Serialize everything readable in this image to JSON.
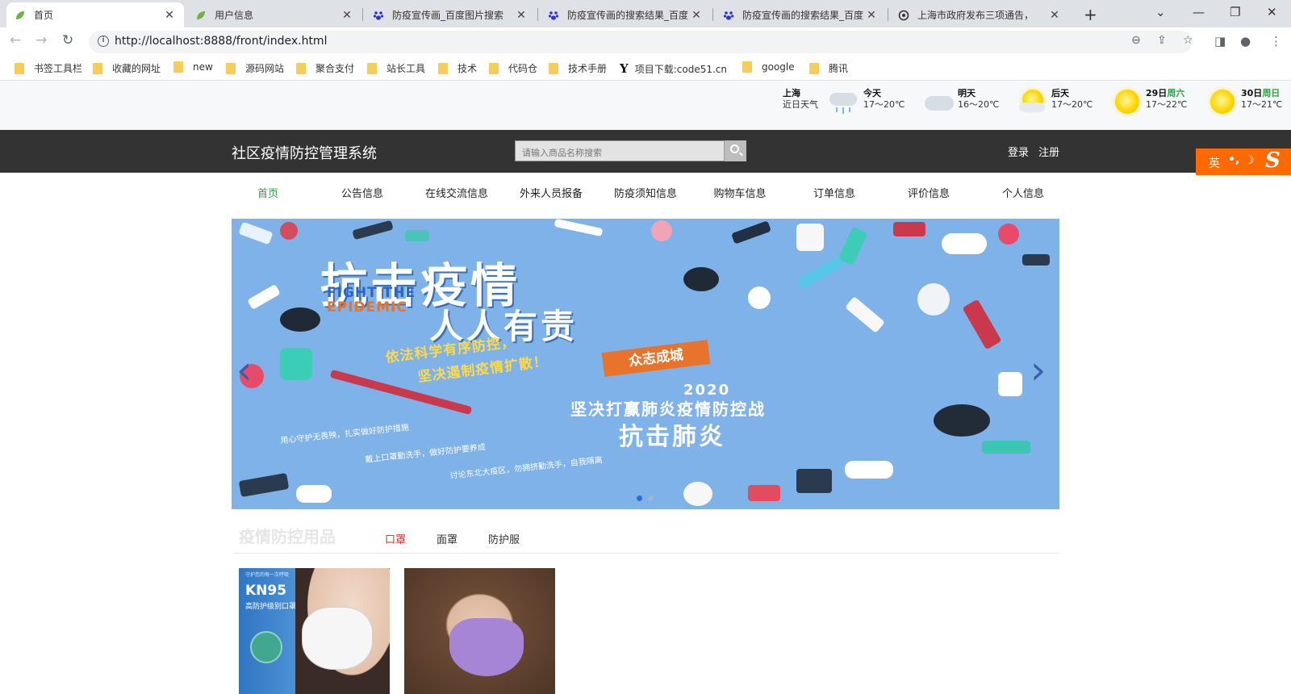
{
  "browser": {
    "tabs": [
      {
        "title": "首页",
        "active": true,
        "icon": "leaf-icon"
      },
      {
        "title": "用户信息",
        "active": false,
        "icon": "leaf-icon"
      },
      {
        "title": "防疫宣传画_百度图片搜索",
        "active": false,
        "icon": "baidu-paw-icon"
      },
      {
        "title": "防疫宣传画的搜索结果_百度",
        "active": false,
        "icon": "baidu-paw-icon"
      },
      {
        "title": "防疫宣传画的搜索结果_百度",
        "active": false,
        "icon": "baidu-paw-icon"
      },
      {
        "title": "上海市政府发布三项通告，",
        "active": false,
        "icon": "emblem-icon"
      }
    ],
    "url": "http://localhost:8888/front/index.html",
    "bookmarks": [
      "书签工具栏",
      "收藏的网址",
      "new",
      "源码网站",
      "聚合支付",
      "站长工具",
      "技术",
      "代码仓",
      "技术手册",
      "项目下载:code51.cn",
      "google",
      "腾讯"
    ]
  },
  "weather": {
    "city": "上海",
    "subtitle": "近日天气",
    "days": [
      {
        "label": "今天",
        "week": "",
        "temp": "17～20℃",
        "icon": "rain-cloud-icon"
      },
      {
        "label": "明天",
        "week": "",
        "temp": "16～20℃",
        "icon": "cloud-icon"
      },
      {
        "label": "后天",
        "week": "",
        "temp": "17～20℃",
        "icon": "sun-cloud-icon"
      },
      {
        "label": "29日",
        "week": "周六",
        "temp": "17～22℃",
        "icon": "sun-icon"
      },
      {
        "label": "30日",
        "week": "周日",
        "temp": "17～21℃",
        "icon": "sun-icon"
      }
    ]
  },
  "header": {
    "site_title": "社区疫情防控管理系统",
    "search_placeholder": "请输入商品名称搜索",
    "login": "登录",
    "register": "注册"
  },
  "ime": {
    "label": "英",
    "punct": "•,",
    "moon": "☽",
    "logo": "S"
  },
  "nav": [
    "首页",
    "公告信息",
    "在线交流信息",
    "外来人员报备",
    "防疫须知信息",
    "购物车信息",
    "订单信息",
    "评价信息",
    "个人信息"
  ],
  "banner": {
    "headline_1": "抗击疫情",
    "headline_2": "人人有责",
    "en_1": "FIGHT THE",
    "en_2": "EPIDEMIC",
    "slogan_1": "依法科学有序防控，",
    "slogan_2": "坚决遏制疫情扩散！",
    "tag": "众志成城",
    "year": "2020",
    "line_1": "坚决打赢肺炎疫情防控战",
    "line_2": "抗击肺炎",
    "small_1": "用心守护无畏殃，扎实做好防护措施",
    "small_2": "戴上口罩勤洗手，做好防护要养成",
    "small_3": "讨论东北大疫区，勿拥挤勤洗手，自我隔离",
    "slide_count": 2,
    "active_slide": 1
  },
  "section": {
    "title": "疫情防控用品",
    "tabs": [
      "口罩",
      "面罩",
      "防护服"
    ],
    "active_tab": 0
  },
  "products": [
    {
      "kn": "KN95",
      "sub": "高防护级别口罩",
      "top": "守护您的每一次呼吸"
    },
    {}
  ]
}
